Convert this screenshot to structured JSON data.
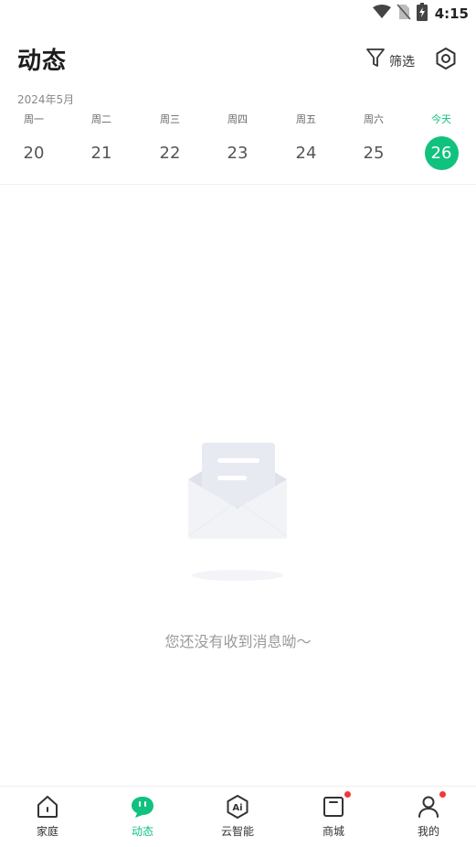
{
  "status_bar": {
    "time": "4:15",
    "icons": [
      "wifi-icon",
      "no-sim-icon",
      "battery-charging-icon"
    ]
  },
  "header": {
    "title": "动态",
    "filter_label": "筛选",
    "filter_icon": "filter-icon",
    "settings_icon": "settings-icon"
  },
  "calendar": {
    "month": "2024年5月",
    "days": [
      {
        "weekday": "周一",
        "date": "20"
      },
      {
        "weekday": "周二",
        "date": "21"
      },
      {
        "weekday": "周三",
        "date": "22"
      },
      {
        "weekday": "周四",
        "date": "23"
      },
      {
        "weekday": "周五",
        "date": "24"
      },
      {
        "weekday": "周六",
        "date": "25"
      },
      {
        "weekday": "今天",
        "date": "26",
        "is_today": true
      }
    ]
  },
  "empty_state": {
    "message": "您还没有收到消息呦～",
    "illustration": "envelope-illustration"
  },
  "bottom_nav": {
    "items": [
      {
        "label": "家庭",
        "icon": "home-icon"
      },
      {
        "label": "动态",
        "icon": "message-icon",
        "active": true
      },
      {
        "label": "云智能",
        "icon": "ai-hexagon-icon"
      },
      {
        "label": "商城",
        "icon": "store-icon",
        "badge": true
      },
      {
        "label": "我的",
        "icon": "profile-icon",
        "badge": true
      }
    ]
  },
  "colors": {
    "accent": "#11c27e",
    "badge": "#f2383a"
  }
}
